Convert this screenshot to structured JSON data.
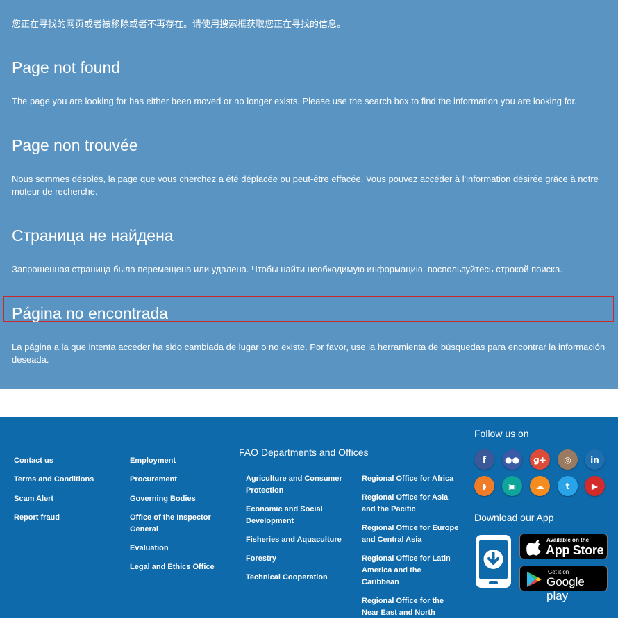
{
  "notice": {
    "zh": "您正在寻找的网页或者被移除或者不再存在。请使用搜索框获取您正在寻找的信息。",
    "en_title": "Page not found",
    "en_text": "The page you are looking for has either been moved or no longer exists. Please use the search box to find the information you are looking for.",
    "fr_title": "Page non trouvée",
    "fr_text": "Nous sommes désolés, la page que vous cherchez a été déplacée ou peut-être effacée. Vous pouvez accéder à l'information désirée grâce à notre moteur de recherche.",
    "ru_title": "Страница не найдена",
    "ru_text": "Запрошенная страница была перемещена или удалена. Чтобы найти необходимую информацию, воспользуйтесь строкой поиска.",
    "es_title": "Página no encontrada",
    "es_text": "La página a la que intenta acceder ha sido cambiada de lugar o no existe. Por favor, use la herramienta de búsquedas para encontrar la información deseada."
  },
  "footer": {
    "col1": [
      "Contact us",
      "Terms and Conditions",
      "Scam Alert",
      "Report fraud"
    ],
    "col2": [
      "Employment",
      "Procurement",
      "Governing Bodies",
      "Office of the Inspector General",
      "Evaluation",
      "Legal and Ethics Office"
    ],
    "departments_title": "FAO Departments and Offices",
    "col3": [
      "Agriculture and Consumer Protection",
      "Economic and Social Development",
      "Fisheries and Aquaculture",
      "Forestry",
      "Technical Cooperation"
    ],
    "col4": [
      "Regional Office for Africa",
      "Regional Office for Asia and the Pacific",
      "Regional Office for Europe and Central Asia",
      "Regional Office for Latin America and the Caribbean",
      "Regional Office for the Near East and North"
    ],
    "follow_title": "Follow us on",
    "social": [
      {
        "icon": "facebook-icon",
        "glyph": "f",
        "color": "#3b5998"
      },
      {
        "icon": "flickr-icon",
        "glyph": "●●",
        "color": "#3a5ba8"
      },
      {
        "icon": "google-plus-icon",
        "glyph": "g+",
        "color": "#dd4b39"
      },
      {
        "icon": "instagram-icon",
        "glyph": "◎",
        "color": "#9a7b61"
      },
      {
        "icon": "linkedin-icon",
        "glyph": "in",
        "color": "#1f6fb0"
      },
      {
        "icon": "rss-icon",
        "glyph": "◗",
        "color": "#f07c28"
      },
      {
        "icon": "slideshare-icon",
        "glyph": "▣",
        "color": "#10a59a"
      },
      {
        "icon": "soundcloud-icon",
        "glyph": "☁",
        "color": "#f58c1f"
      },
      {
        "icon": "twitter-icon",
        "glyph": "t",
        "color": "#2aa3e8"
      },
      {
        "icon": "youtube-icon",
        "glyph": "▶",
        "color": "#d32a2a"
      }
    ],
    "app_title": "Download our App",
    "appstore_small": "Available on the",
    "appstore_big": "App Store",
    "googleplay_small": "Get it on",
    "googleplay_big": "Google play"
  }
}
